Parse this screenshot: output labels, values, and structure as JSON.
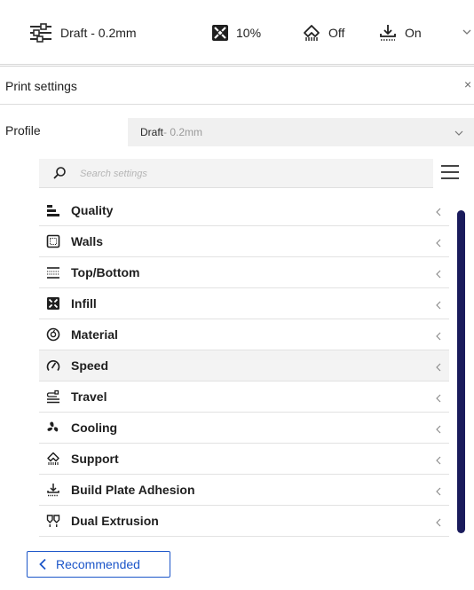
{
  "toolbar": {
    "profile_label": "Draft - 0.2mm",
    "infill_label": "10%",
    "support_label": "Off",
    "adhesion_label": "On",
    "icons": [
      "print-settings-icon",
      "infill-icon",
      "support-icon",
      "adhesion-icon",
      "chevron-down-icon"
    ]
  },
  "panel": {
    "title": "Print settings",
    "close_symbol": "×"
  },
  "profile": {
    "label": "Profile",
    "name": "Draft",
    "suffix": " - 0.2mm"
  },
  "search": {
    "placeholder": "Search settings",
    "value": ""
  },
  "categories": [
    {
      "label": "Quality",
      "icon": "quality-icon"
    },
    {
      "label": "Walls",
      "icon": "walls-icon"
    },
    {
      "label": "Top/Bottom",
      "icon": "top-bottom-icon"
    },
    {
      "label": "Infill",
      "icon": "infill-icon"
    },
    {
      "label": "Material",
      "icon": "material-icon"
    },
    {
      "label": "Speed",
      "icon": "speed-icon",
      "highlighted": true
    },
    {
      "label": "Travel",
      "icon": "travel-icon"
    },
    {
      "label": "Cooling",
      "icon": "cooling-icon"
    },
    {
      "label": "Support",
      "icon": "support-icon"
    },
    {
      "label": "Build Plate Adhesion",
      "icon": "build-plate-adhesion-icon"
    },
    {
      "label": "Dual Extrusion",
      "icon": "dual-extrusion-icon"
    }
  ],
  "footer": {
    "recommended_label": "Recommended"
  },
  "colors": {
    "accent": "#1c56c9",
    "scrollbar": "#1a1b5c",
    "highlight_row": "#f3f3f3"
  }
}
